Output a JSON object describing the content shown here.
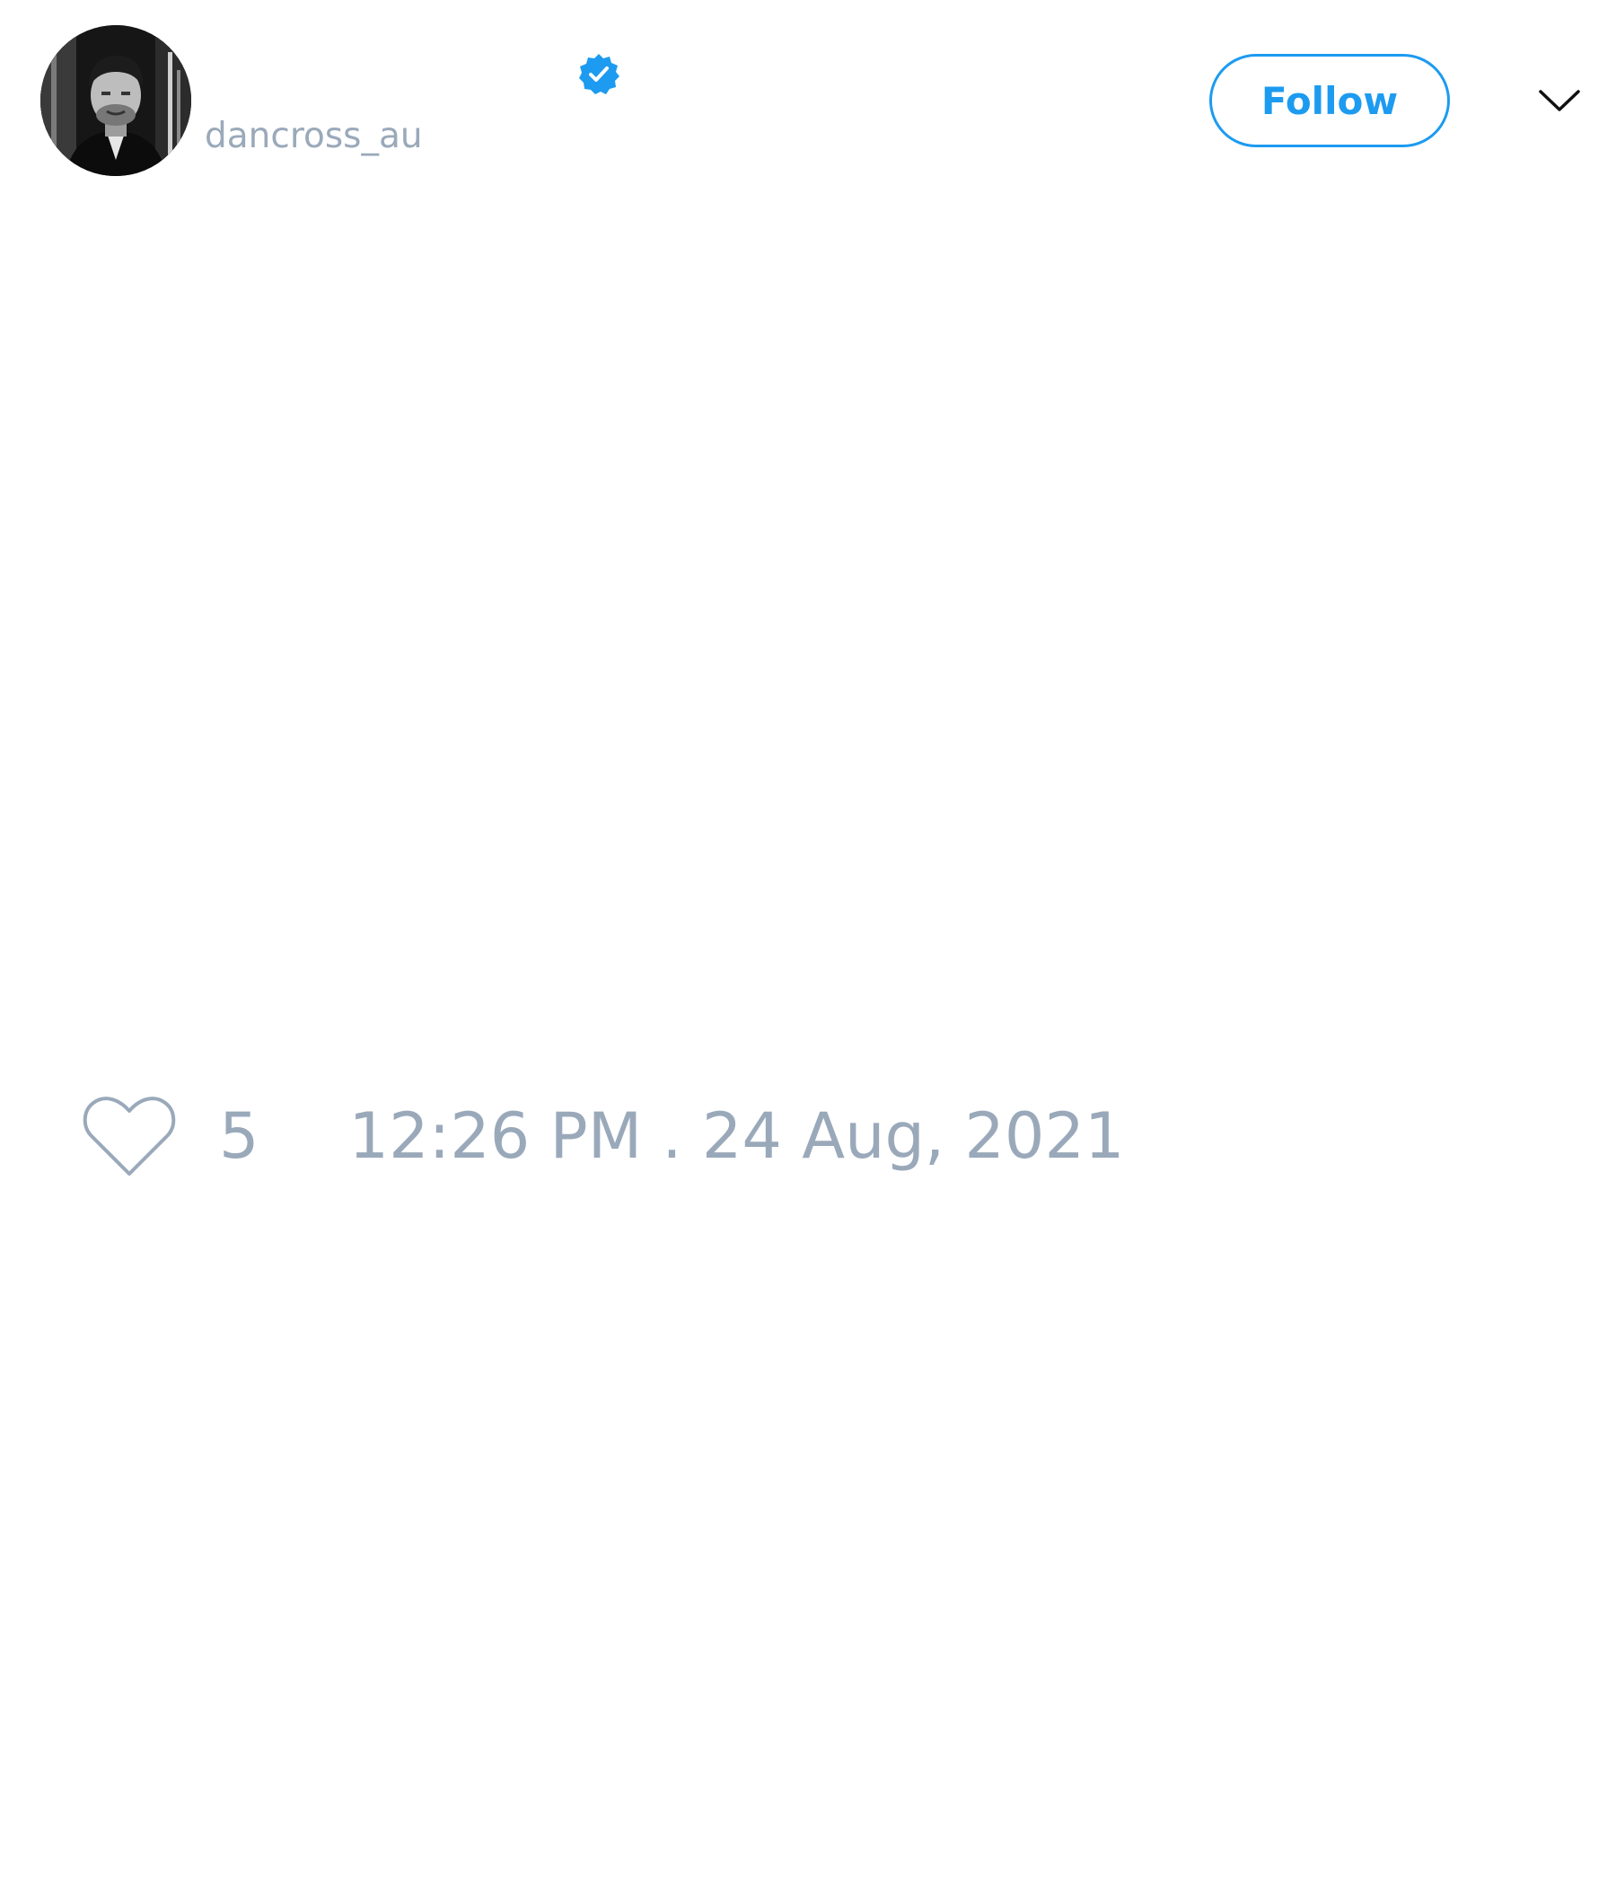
{
  "tweet": {
    "author": {
      "display_name": "",
      "handle": "dancross_au",
      "verified": true,
      "avatar_icon": "profile-photo-icon"
    },
    "follow_label": "Follow",
    "more_icon": "chevron-down-icon",
    "like_icon": "heart-outline-icon",
    "like_count": "5",
    "timestamp": "12:26 PM . 24 Aug, 2021"
  },
  "colors": {
    "accent": "#1d9bf0",
    "muted_text": "#9aa9ba",
    "background": "#ffffff"
  }
}
